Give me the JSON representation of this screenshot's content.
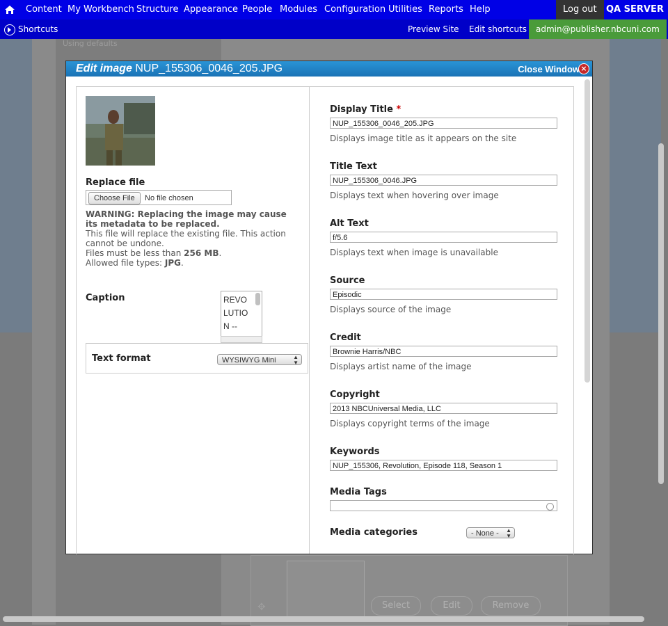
{
  "toolbar": {
    "items": [
      "Content",
      "My Workbench",
      "Structure",
      "Appearance",
      "People",
      "Modules",
      "Configuration",
      "Utilities",
      "Reports",
      "Help"
    ],
    "logout": "Log out",
    "server": "QA SERVER"
  },
  "shortcuts_bar": {
    "shortcuts": "Shortcuts",
    "preview": "Preview Site",
    "edit_shortcuts": "Edit shortcuts",
    "user": "admin@publisher.nbcuni.com"
  },
  "background": {
    "using_defaults": "Using defaults",
    "buttons": [
      "Select",
      "Edit",
      "Remove"
    ]
  },
  "modal": {
    "title_prefix": "Edit image",
    "title_file": "NUP_155306_0046_205.JPG",
    "close": "Close Window"
  },
  "left": {
    "replace_file_label": "Replace file",
    "choose_file": "Choose File",
    "no_file": "No file chosen",
    "warning": "WARNING: Replacing the image may cause its metadata to be replaced.",
    "replace_note": "This file will replace the existing file. This action cannot be undone.",
    "size_prefix": "Files must be less than",
    "size_value": "256 MB",
    "types_prefix": "Allowed file types:",
    "types_value": "JPG",
    "caption_label": "Caption",
    "caption_lines": [
      "REVO",
      "LUTIO",
      "N --"
    ],
    "text_format_label": "Text format",
    "text_format_value": "WYSIWYG Mini"
  },
  "right": {
    "display_title": {
      "label": "Display Title",
      "required": "*",
      "value": "NUP_155306_0046_205.JPG",
      "desc": "Displays image title as it appears on the site"
    },
    "title_text": {
      "label": "Title Text",
      "value": "NUP_155306_0046.JPG",
      "desc": "Displays text when hovering over image"
    },
    "alt_text": {
      "label": "Alt Text",
      "value": "f/5.6",
      "desc": "Displays text when image is unavailable"
    },
    "source": {
      "label": "Source",
      "value": "Episodic",
      "desc": "Displays source of the image"
    },
    "credit": {
      "label": "Credit",
      "value": "Brownie Harris/NBC",
      "desc": "Displays artist name of the image"
    },
    "copyright": {
      "label": "Copyright",
      "value": "2013 NBCUniversal Media, LLC",
      "desc": "Displays copyright terms of the image"
    },
    "keywords": {
      "label": "Keywords",
      "value": "NUP_155306, Revolution, Episode 118, Season 1"
    },
    "media_tags": {
      "label": "Media Tags",
      "value": ""
    },
    "media_categories": {
      "label": "Media categories",
      "value": "- None -"
    }
  }
}
